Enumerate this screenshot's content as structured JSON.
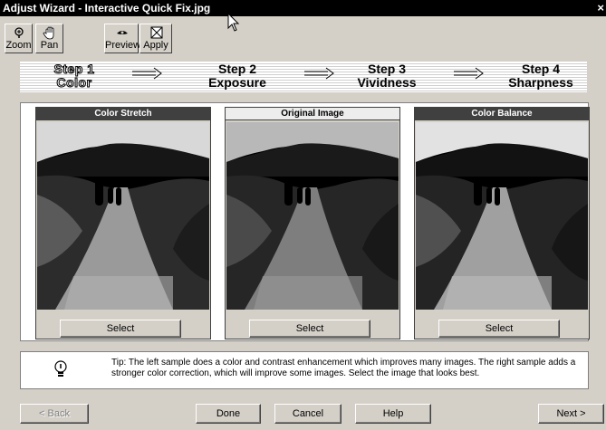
{
  "window": {
    "title": "Adjust Wizard - Interactive Quick Fix.jpg",
    "close_label": "×"
  },
  "toolbar": {
    "zoom_label": "Zoom",
    "pan_label": "Pan",
    "preview_label": "Preview",
    "apply_label": "Apply"
  },
  "steps": [
    {
      "step": "Step 1",
      "name": "Color",
      "active": true
    },
    {
      "step": "Step 2",
      "name": "Exposure",
      "active": false
    },
    {
      "step": "Step 3",
      "name": "Vividness",
      "active": false
    },
    {
      "step": "Step 4",
      "name": "Sharpness",
      "active": false
    }
  ],
  "samples": [
    {
      "title": "Color Stretch",
      "select_label": "Select"
    },
    {
      "title": "Original Image",
      "select_label": "Select"
    },
    {
      "title": "Color Balance",
      "select_label": "Select"
    }
  ],
  "tip": {
    "text": "Tip: The left sample does a color and contrast enhancement which improves many images. The right sample adds a stronger color correction, which will improve some images. Select the image that looks best."
  },
  "buttons": {
    "back_label": "< Back",
    "done_label": "Done",
    "cancel_label": "Cancel",
    "help_label": "Help",
    "next_label": "Next >"
  },
  "icons": {
    "zoom": "magnifier-icon",
    "pan": "hand-icon",
    "preview": "eye-icon",
    "apply": "apply-icon",
    "tip": "lightbulb-icon",
    "step_arrow": "right-arrow-icon"
  }
}
